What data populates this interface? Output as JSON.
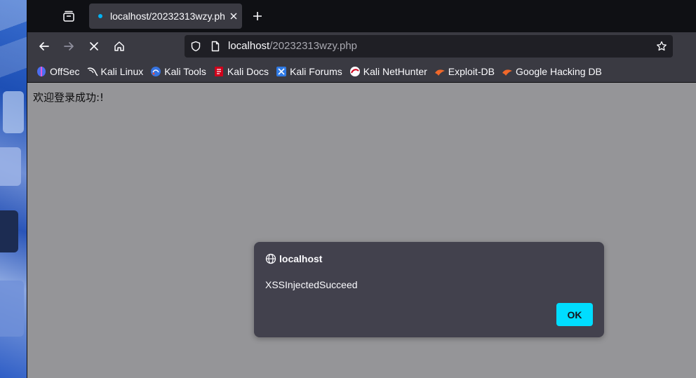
{
  "tab": {
    "title": "localhost/20232313wzy.php",
    "favicon_icon": "page-loading-icon",
    "close_icon": "close-icon"
  },
  "toolbar": {
    "back_icon": "back-arrow-icon",
    "forward_icon": "forward-arrow-icon",
    "stop_icon": "stop-icon",
    "home_icon": "home-icon"
  },
  "urlbar": {
    "host": "localhost",
    "path": "/20232313wzy.php"
  },
  "bookmarks": [
    {
      "label": "OffSec",
      "icon": "offsec-icon"
    },
    {
      "label": "Kali Linux",
      "icon": "kali-dragon-icon"
    },
    {
      "label": "Kali Tools",
      "icon": "kali-tools-icon"
    },
    {
      "label": "Kali Docs",
      "icon": "kali-docs-icon"
    },
    {
      "label": "Kali Forums",
      "icon": "kali-forums-icon"
    },
    {
      "label": "Kali NetHunter",
      "icon": "nethunter-icon"
    },
    {
      "label": "Exploit-DB",
      "icon": "exploit-db-icon"
    },
    {
      "label": "Google Hacking DB",
      "icon": "ghdb-icon"
    }
  ],
  "page": {
    "message": "欢迎登录成功:!"
  },
  "dialog": {
    "host": "localhost",
    "message": "XSSInjectedSucceed",
    "ok_label": "OK"
  },
  "colors": {
    "accent": "#00ddff",
    "dialog_bg": "#42414d",
    "toolbar_bg": "#3a3a42",
    "content_bg": "#959598"
  }
}
